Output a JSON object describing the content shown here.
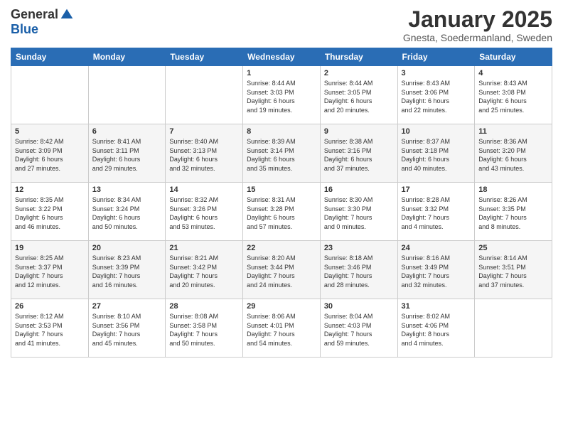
{
  "header": {
    "logo_general": "General",
    "logo_blue": "Blue",
    "month_title": "January 2025",
    "location": "Gnesta, Soedermanland, Sweden"
  },
  "weekdays": [
    "Sunday",
    "Monday",
    "Tuesday",
    "Wednesday",
    "Thursday",
    "Friday",
    "Saturday"
  ],
  "weeks": [
    [
      {
        "day": "",
        "info": ""
      },
      {
        "day": "",
        "info": ""
      },
      {
        "day": "",
        "info": ""
      },
      {
        "day": "1",
        "info": "Sunrise: 8:44 AM\nSunset: 3:03 PM\nDaylight: 6 hours\nand 19 minutes."
      },
      {
        "day": "2",
        "info": "Sunrise: 8:44 AM\nSunset: 3:05 PM\nDaylight: 6 hours\nand 20 minutes."
      },
      {
        "day": "3",
        "info": "Sunrise: 8:43 AM\nSunset: 3:06 PM\nDaylight: 6 hours\nand 22 minutes."
      },
      {
        "day": "4",
        "info": "Sunrise: 8:43 AM\nSunset: 3:08 PM\nDaylight: 6 hours\nand 25 minutes."
      }
    ],
    [
      {
        "day": "5",
        "info": "Sunrise: 8:42 AM\nSunset: 3:09 PM\nDaylight: 6 hours\nand 27 minutes."
      },
      {
        "day": "6",
        "info": "Sunrise: 8:41 AM\nSunset: 3:11 PM\nDaylight: 6 hours\nand 29 minutes."
      },
      {
        "day": "7",
        "info": "Sunrise: 8:40 AM\nSunset: 3:13 PM\nDaylight: 6 hours\nand 32 minutes."
      },
      {
        "day": "8",
        "info": "Sunrise: 8:39 AM\nSunset: 3:14 PM\nDaylight: 6 hours\nand 35 minutes."
      },
      {
        "day": "9",
        "info": "Sunrise: 8:38 AM\nSunset: 3:16 PM\nDaylight: 6 hours\nand 37 minutes."
      },
      {
        "day": "10",
        "info": "Sunrise: 8:37 AM\nSunset: 3:18 PM\nDaylight: 6 hours\nand 40 minutes."
      },
      {
        "day": "11",
        "info": "Sunrise: 8:36 AM\nSunset: 3:20 PM\nDaylight: 6 hours\nand 43 minutes."
      }
    ],
    [
      {
        "day": "12",
        "info": "Sunrise: 8:35 AM\nSunset: 3:22 PM\nDaylight: 6 hours\nand 46 minutes."
      },
      {
        "day": "13",
        "info": "Sunrise: 8:34 AM\nSunset: 3:24 PM\nDaylight: 6 hours\nand 50 minutes."
      },
      {
        "day": "14",
        "info": "Sunrise: 8:32 AM\nSunset: 3:26 PM\nDaylight: 6 hours\nand 53 minutes."
      },
      {
        "day": "15",
        "info": "Sunrise: 8:31 AM\nSunset: 3:28 PM\nDaylight: 6 hours\nand 57 minutes."
      },
      {
        "day": "16",
        "info": "Sunrise: 8:30 AM\nSunset: 3:30 PM\nDaylight: 7 hours\nand 0 minutes."
      },
      {
        "day": "17",
        "info": "Sunrise: 8:28 AM\nSunset: 3:32 PM\nDaylight: 7 hours\nand 4 minutes."
      },
      {
        "day": "18",
        "info": "Sunrise: 8:26 AM\nSunset: 3:35 PM\nDaylight: 7 hours\nand 8 minutes."
      }
    ],
    [
      {
        "day": "19",
        "info": "Sunrise: 8:25 AM\nSunset: 3:37 PM\nDaylight: 7 hours\nand 12 minutes."
      },
      {
        "day": "20",
        "info": "Sunrise: 8:23 AM\nSunset: 3:39 PM\nDaylight: 7 hours\nand 16 minutes."
      },
      {
        "day": "21",
        "info": "Sunrise: 8:21 AM\nSunset: 3:42 PM\nDaylight: 7 hours\nand 20 minutes."
      },
      {
        "day": "22",
        "info": "Sunrise: 8:20 AM\nSunset: 3:44 PM\nDaylight: 7 hours\nand 24 minutes."
      },
      {
        "day": "23",
        "info": "Sunrise: 8:18 AM\nSunset: 3:46 PM\nDaylight: 7 hours\nand 28 minutes."
      },
      {
        "day": "24",
        "info": "Sunrise: 8:16 AM\nSunset: 3:49 PM\nDaylight: 7 hours\nand 32 minutes."
      },
      {
        "day": "25",
        "info": "Sunrise: 8:14 AM\nSunset: 3:51 PM\nDaylight: 7 hours\nand 37 minutes."
      }
    ],
    [
      {
        "day": "26",
        "info": "Sunrise: 8:12 AM\nSunset: 3:53 PM\nDaylight: 7 hours\nand 41 minutes."
      },
      {
        "day": "27",
        "info": "Sunrise: 8:10 AM\nSunset: 3:56 PM\nDaylight: 7 hours\nand 45 minutes."
      },
      {
        "day": "28",
        "info": "Sunrise: 8:08 AM\nSunset: 3:58 PM\nDaylight: 7 hours\nand 50 minutes."
      },
      {
        "day": "29",
        "info": "Sunrise: 8:06 AM\nSunset: 4:01 PM\nDaylight: 7 hours\nand 54 minutes."
      },
      {
        "day": "30",
        "info": "Sunrise: 8:04 AM\nSunset: 4:03 PM\nDaylight: 7 hours\nand 59 minutes."
      },
      {
        "day": "31",
        "info": "Sunrise: 8:02 AM\nSunset: 4:06 PM\nDaylight: 8 hours\nand 4 minutes."
      },
      {
        "day": "",
        "info": ""
      }
    ]
  ]
}
